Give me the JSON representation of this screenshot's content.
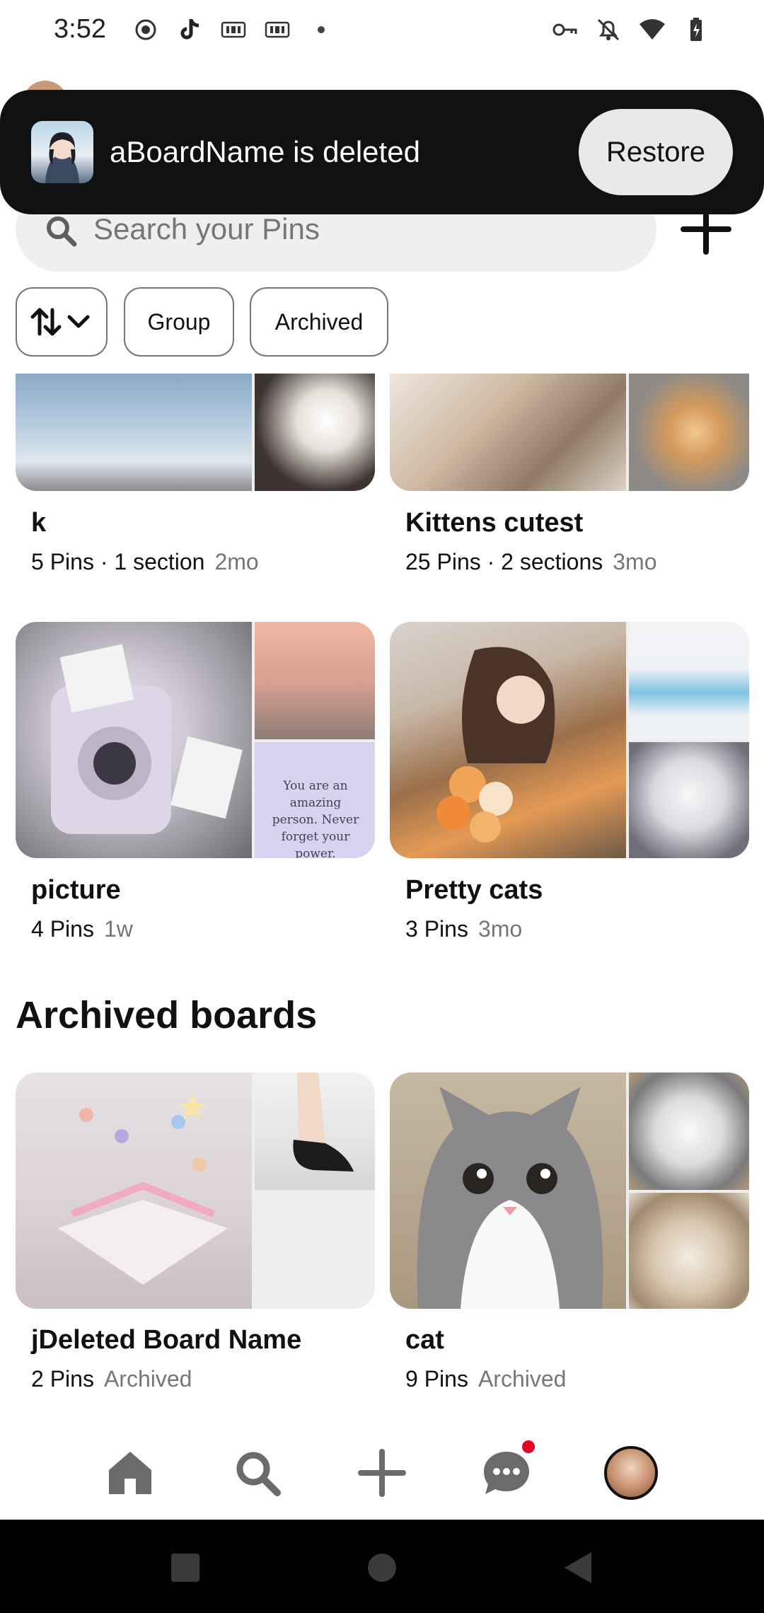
{
  "status_bar": {
    "time": "3:52",
    "left_icons": [
      "record-icon",
      "tiktok-icon",
      "iqiyi-icon",
      "iqiyi-icon",
      "dot-icon"
    ],
    "right_icons": [
      "vpn-key-icon",
      "notifications-off-icon",
      "wifi-icon",
      "battery-charging-icon"
    ]
  },
  "snackbar": {
    "message": "aBoardName is deleted",
    "action_label": "Restore"
  },
  "search": {
    "placeholder": "Search your Pins"
  },
  "filters": {
    "group_label": "Group",
    "archived_label": "Archived"
  },
  "boards": [
    {
      "title": "k",
      "pins": "5 Pins · 1 section",
      "age": "2mo"
    },
    {
      "title": "Kittens cutest",
      "pins": "25 Pins · 2 sections",
      "age": "3mo"
    },
    {
      "title": "picture",
      "pins": "4 Pins",
      "age": "1w",
      "quote": "You are an amazing person. Never forget your power."
    },
    {
      "title": "Pretty cats",
      "pins": "3 Pins",
      "age": "3mo"
    }
  ],
  "archived_section": {
    "heading": "Archived boards",
    "boards": [
      {
        "title": "jDeleted Board Name",
        "pins": "2 Pins",
        "status": "Archived"
      },
      {
        "title": "cat",
        "pins": "9 Pins",
        "status": "Archived"
      }
    ]
  },
  "bottom_nav": {
    "items": [
      "home-icon",
      "search-icon",
      "create-icon",
      "messages-icon",
      "profile-avatar"
    ],
    "notification_color": "#e60023"
  },
  "colors": {
    "snackbar_bg": "#111111",
    "search_bg": "#efefef",
    "muted_text": "#767676"
  }
}
